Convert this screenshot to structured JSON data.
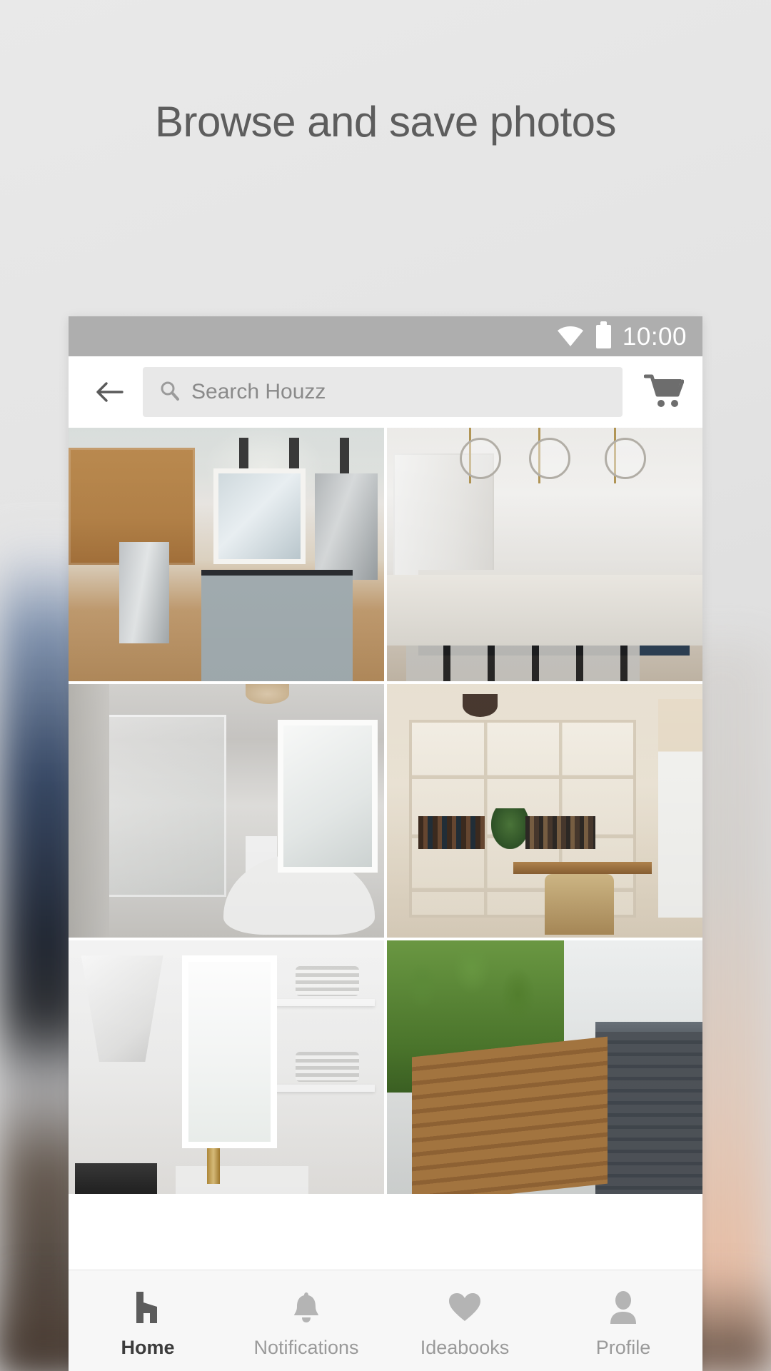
{
  "promo": {
    "headline": "Browse and save photos"
  },
  "colors": {
    "statusbar_bg": "#aeaeae",
    "appbar_bg": "#ffffff",
    "search_field_bg": "#e8e8e8",
    "bottomnav_bg": "#f7f7f7",
    "active_nav": "#3c3c3c",
    "inactive_nav": "#9a9a9a",
    "headline_text": "#5d5d5d"
  },
  "statusbar": {
    "wifi_icon": "wifi-icon",
    "battery_icon": "battery-full-icon",
    "clock": "10:00"
  },
  "appbar": {
    "back_icon": "back-arrow-icon",
    "cart_icon": "shopping-cart-icon",
    "search": {
      "icon": "search-icon",
      "value": "",
      "placeholder": "Search Houzz"
    }
  },
  "photo_grid": {
    "columns": 2,
    "items": [
      {
        "id": "photo-1",
        "alt": "Traditional kitchen with maple cabinets, gray island and bar stools"
      },
      {
        "id": "photo-2",
        "alt": "White kitchen with navy island, marble waterfall counter and glass globe pendants"
      },
      {
        "id": "photo-3",
        "alt": "Gray master bathroom with glass steam shower and freestanding soaking tub"
      },
      {
        "id": "photo-4",
        "alt": "Built-in white bookshelves with record storage and wood desk nook"
      },
      {
        "id": "photo-5",
        "alt": "All white kitchen with chimney hood, open shelving and brass faucet"
      },
      {
        "id": "photo-6",
        "alt": "Backyard exterior with cedar fence, climbing vines and gray siding"
      }
    ]
  },
  "bottom_nav": {
    "items": [
      {
        "label": "Home",
        "icon": "houzz-home-icon",
        "active": true
      },
      {
        "label": "Notifications",
        "icon": "bell-icon",
        "active": false
      },
      {
        "label": "Ideabooks",
        "icon": "heart-icon",
        "active": false
      },
      {
        "label": "Profile",
        "icon": "person-icon",
        "active": false
      }
    ]
  }
}
